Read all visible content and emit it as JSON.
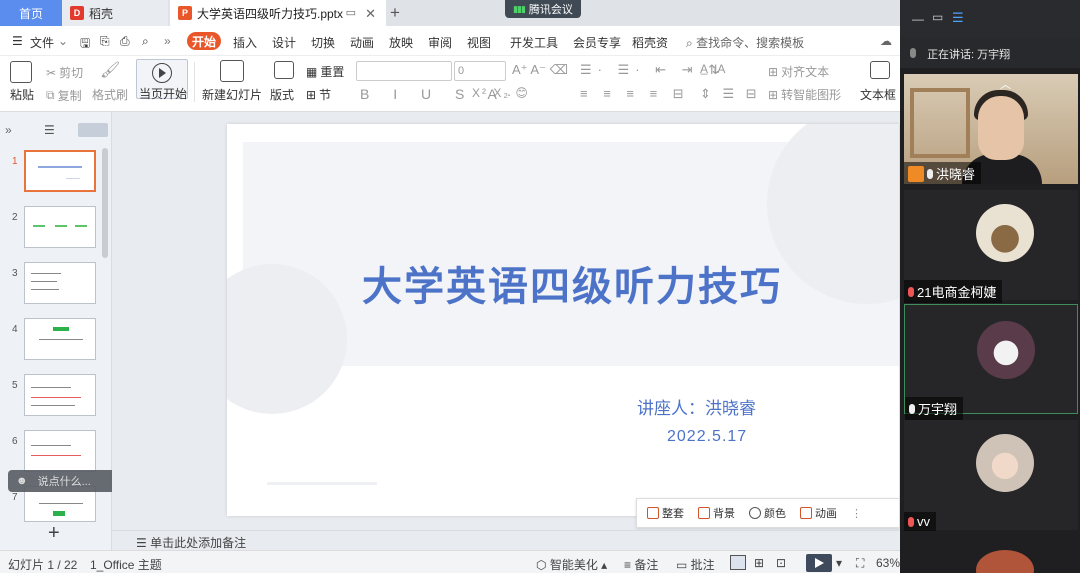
{
  "tabs": {
    "home": "首页",
    "daoke": "稻壳",
    "doc": "大学英语四级听力技巧.pptx",
    "meeting": "腾讯会议"
  },
  "menu": {
    "items": [
      "文件",
      "开始",
      "插入",
      "设计",
      "切换",
      "动画",
      "放映",
      "审阅",
      "视图",
      "开发工具",
      "会员专享",
      "稻壳资"
    ],
    "search": "查找命令、搜索模板"
  },
  "ribbon": {
    "paste": "粘贴",
    "cut": "剪切",
    "copy": "复制",
    "format_painter": "格式刷",
    "play_from_current": "当页开始",
    "new_slide": "新建幻灯片",
    "layout": "版式",
    "section": "节",
    "reset": "重置",
    "font_size": "0",
    "align_text": "对齐文本",
    "smart_shape": "转智能图形",
    "textbox": "文本框"
  },
  "slides": {
    "count_label": "幻灯片 1 / 22",
    "numbers": [
      "1",
      "2",
      "3",
      "4",
      "5",
      "6",
      "7"
    ]
  },
  "slide": {
    "title": "大学英语四级听力技巧",
    "speaker": "讲座人：洪晓睿",
    "date": "2022.5.17"
  },
  "floatbar": {
    "template": "整套",
    "background": "背景",
    "color": "颜色",
    "animation": "动画"
  },
  "chat_placeholder": "说点什么...",
  "notes_placeholder": "单击此处添加备注",
  "statusbar": {
    "theme": "1_Office 主题",
    "beautify": "智能美化",
    "notes": "备注",
    "comments": "批注",
    "zoom": "63%"
  },
  "meeting": {
    "speaking": "正在讲话: 万宇翔",
    "participants": [
      "洪晓睿",
      "21电商金柯婕",
      "万宇翔",
      "vv"
    ]
  },
  "colors": {
    "accent": "#e8562a",
    "slide_text": "#4d73c9",
    "home_tab": "#5b8def"
  }
}
